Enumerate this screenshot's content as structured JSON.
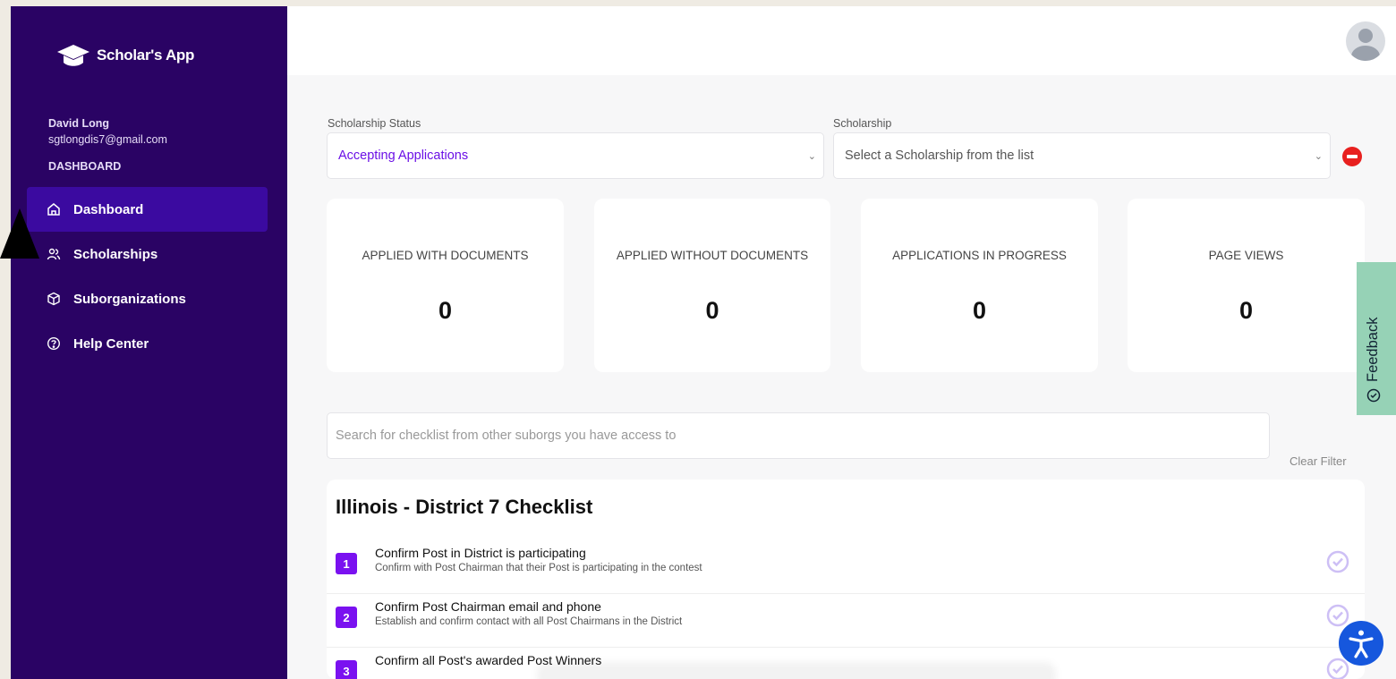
{
  "brand": {
    "name": "Scholar's App"
  },
  "user": {
    "name": "David Long",
    "email": "sgtlongdis7@gmail.com"
  },
  "sidebar": {
    "section_label": "DASHBOARD",
    "items": [
      {
        "label": "Dashboard",
        "icon": "home-icon",
        "active": true
      },
      {
        "label": "Scholarships",
        "icon": "users-icon",
        "active": false
      },
      {
        "label": "Suborganizations",
        "icon": "cube-icon",
        "active": false
      },
      {
        "label": "Help Center",
        "icon": "question-circle-icon",
        "active": false
      }
    ]
  },
  "filters": {
    "status_label": "Scholarship Status",
    "status_value": "Accepting Applications",
    "scholarship_label": "Scholarship",
    "scholarship_placeholder": "Select a Scholarship from the list"
  },
  "stats": [
    {
      "label": "APPLIED WITH DOCUMENTS",
      "value": "0"
    },
    {
      "label": "APPLIED WITHOUT DOCUMENTS",
      "value": "0"
    },
    {
      "label": "APPLICATIONS IN PROGRESS",
      "value": "0"
    },
    {
      "label": "PAGE VIEWS",
      "value": "0"
    }
  ],
  "feedback": {
    "label": "Feedback"
  },
  "search": {
    "placeholder": "Search for checklist from other suborgs you have access to",
    "clear_label": "Clear Filter"
  },
  "checklist": {
    "title": "Illinois - District 7 Checklist",
    "items": [
      {
        "num": "1",
        "title": "Confirm Post in District is participating",
        "desc": "Confirm with Post Chairman that their Post is participating in the contest"
      },
      {
        "num": "2",
        "title": "Confirm Post Chairman email and phone",
        "desc": "Establish and confirm contact with all Post Chairmans in the District"
      },
      {
        "num": "3",
        "title": "Confirm all Post's awarded Post Winners",
        "desc": ""
      }
    ]
  },
  "colors": {
    "sidebar_bg": "#2a0364",
    "accent": "#7a11f0",
    "feedback_bg": "#96d2b6",
    "danger": "#e8201f"
  }
}
